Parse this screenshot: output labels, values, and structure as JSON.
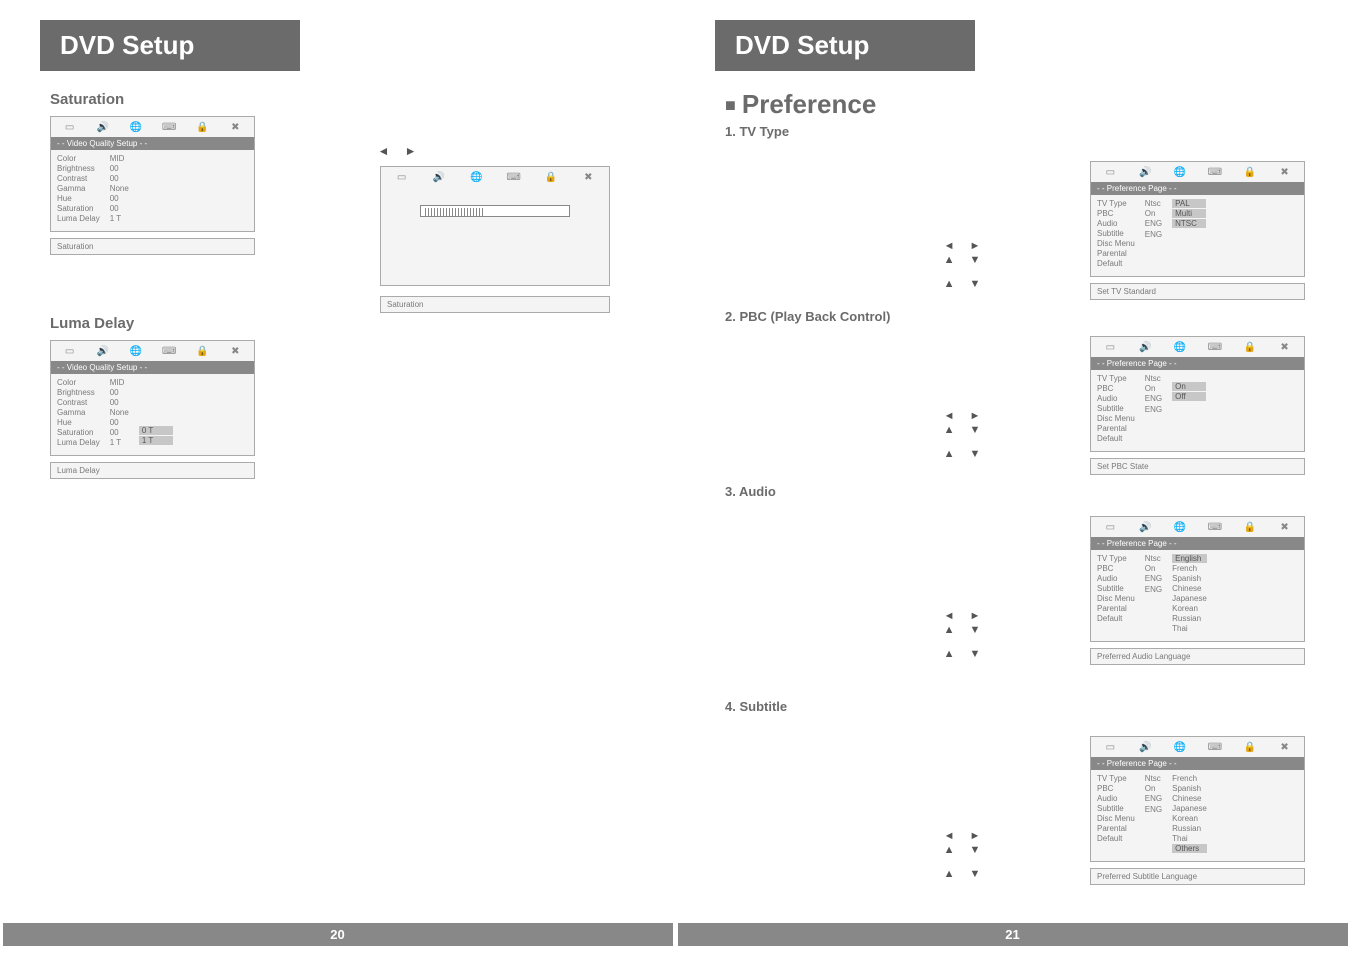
{
  "left_page_number": "20",
  "right_page_number": "21",
  "title": "DVD Setup",
  "preference_title": "Preference",
  "sections": {
    "saturation": "Saturation",
    "luma": "Luma Delay",
    "tvtype": "1. TV Type",
    "pbc": "2. PBC (Play Back Control)",
    "audio": "3. Audio",
    "subtitle": "4. Subtitle"
  },
  "video_quality_header": "- - Video Quality Setup - -",
  "preference_header": "- - Preference Page - -",
  "saturation_panel": {
    "items": [
      "Color",
      "Brightness",
      "Contrast",
      "Gamma",
      "Hue",
      "Saturation",
      "Luma Delay"
    ],
    "values": [
      "MID",
      "00",
      "00",
      "None",
      "00",
      "00",
      "1 T"
    ],
    "footer": "Saturation"
  },
  "saturation_right_footer": "Saturation",
  "luma_panel": {
    "items": [
      "Color",
      "Brightness",
      "Contrast",
      "Gamma",
      "Hue",
      "Saturation",
      "Luma Delay"
    ],
    "values": [
      "MID",
      "00",
      "00",
      "None",
      "00",
      "00",
      "1 T"
    ],
    "options": [
      "0 T",
      "1 T"
    ],
    "footer": "Luma Delay"
  },
  "tvtype_panel": {
    "items": [
      "TV Type",
      "PBC",
      "Audio",
      "Subtitle",
      "Disc Menu",
      "Parental",
      "Default"
    ],
    "values": [
      "Ntsc",
      "On",
      "ENG",
      "",
      "ENG",
      "",
      ""
    ],
    "options": [
      "PAL",
      "Multi",
      "NTSC"
    ],
    "footer": "Set TV Standard"
  },
  "pbc_panel": {
    "items": [
      "TV Type",
      "PBC",
      "Audio",
      "Subtitle",
      "Disc Menu",
      "Parental",
      "Default"
    ],
    "values": [
      "Ntsc",
      "On",
      "ENG",
      "",
      "ENG",
      "",
      ""
    ],
    "options": [
      "On",
      "Off"
    ],
    "footer": "Set PBC State"
  },
  "audio_panel": {
    "items": [
      "TV Type",
      "PBC",
      "Audio",
      "Subtitle",
      "Disc Menu",
      "Parental",
      "Default"
    ],
    "values": [
      "Ntsc",
      "On",
      "ENG",
      "",
      "ENG",
      "",
      ""
    ],
    "options": [
      "English",
      "French",
      "Spanish",
      "Chinese",
      "Japanese",
      "Korean",
      "Russian",
      "Thai"
    ],
    "footer": "Preferred Audio Language"
  },
  "subtitle_panel": {
    "items": [
      "TV Type",
      "PBC",
      "Audio",
      "Subtitle",
      "Disc Menu",
      "Parental",
      "Default"
    ],
    "values": [
      "Ntsc",
      "On",
      "ENG",
      "",
      "ENG",
      "",
      ""
    ],
    "options": [
      "French",
      "Spanish",
      "Chinese",
      "Japanese",
      "Korean",
      "Russian",
      "Thai",
      "Others"
    ],
    "footer": "Preferred Subtitle Language"
  },
  "arrows": {
    "lr": "◄ ►",
    "ud_small": "▲ ▼",
    "ud": "▲  ▼"
  },
  "icons": [
    "▭",
    "🔊",
    "🌐",
    "⌨",
    "🔒",
    "✖"
  ]
}
